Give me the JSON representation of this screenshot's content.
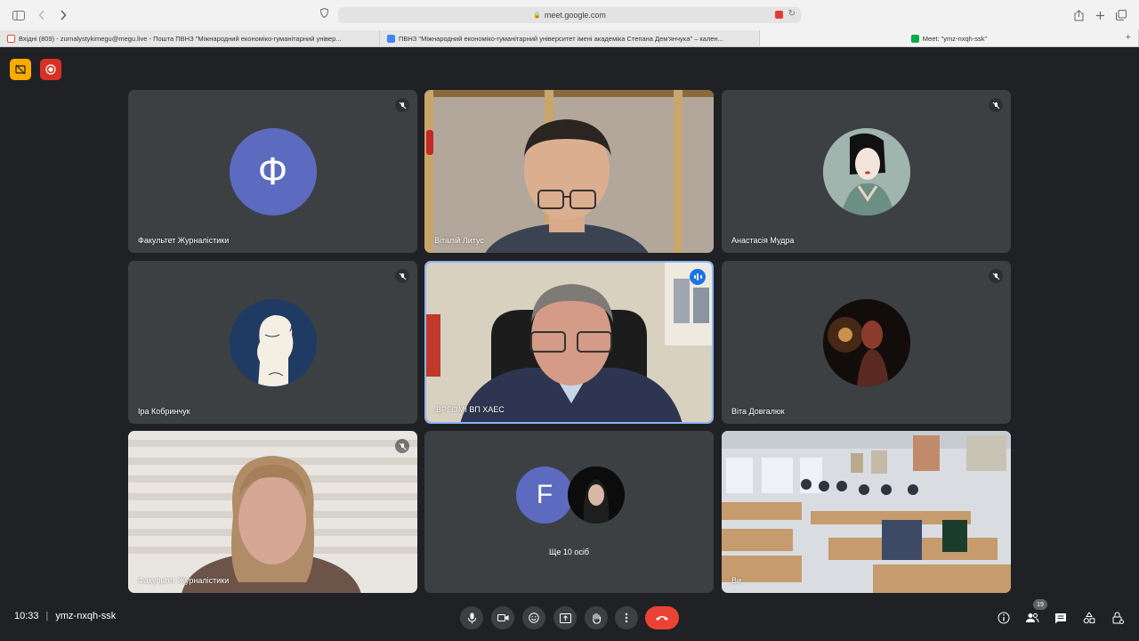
{
  "browser": {
    "url": "meet.google.com",
    "tabs": [
      {
        "label": "Вхідні (809) - zurnalystykimegu@megu.live - Пошта ПВНЗ \"Міжнародний економіко-гуманітарний універ..."
      },
      {
        "label": "ПВНЗ \"Міжнародний економіко-гуманітарний університет імені академіка Степана Дем'янчука\" – кален..."
      },
      {
        "label": "Meet: \"ymz-nxqh-ssk\""
      }
    ]
  },
  "participants": [
    {
      "name": "Факультет Журналістики",
      "avatar_letter": "Ф",
      "avatar_color": "#5c6bc0",
      "muted": true
    },
    {
      "name": "Віталій Литус",
      "muted": false
    },
    {
      "name": "Анастасія Мудра",
      "muted": true
    },
    {
      "name": "Іра Кобринчук",
      "muted": true
    },
    {
      "name": "ВРГІЗМІ ВП ХАЕС",
      "muted": false,
      "speaking": true
    },
    {
      "name": "Віта Довгалюк",
      "muted": true
    },
    {
      "name": "Факультет Журналістики",
      "muted": true
    },
    {
      "others_label": "Ще 10 осіб",
      "avatar_letter": "F",
      "avatar_color": "#5c6bc0"
    },
    {
      "name": "Ви"
    }
  ],
  "bottom_bar": {
    "time": "10:33",
    "separator": "|",
    "meeting_code": "ymz-nxqh-ssk",
    "participant_count": "19"
  },
  "colors": {
    "background": "#202124",
    "tile": "#3c4043",
    "hangup": "#ea4335",
    "speaking": "#1a73e8"
  }
}
